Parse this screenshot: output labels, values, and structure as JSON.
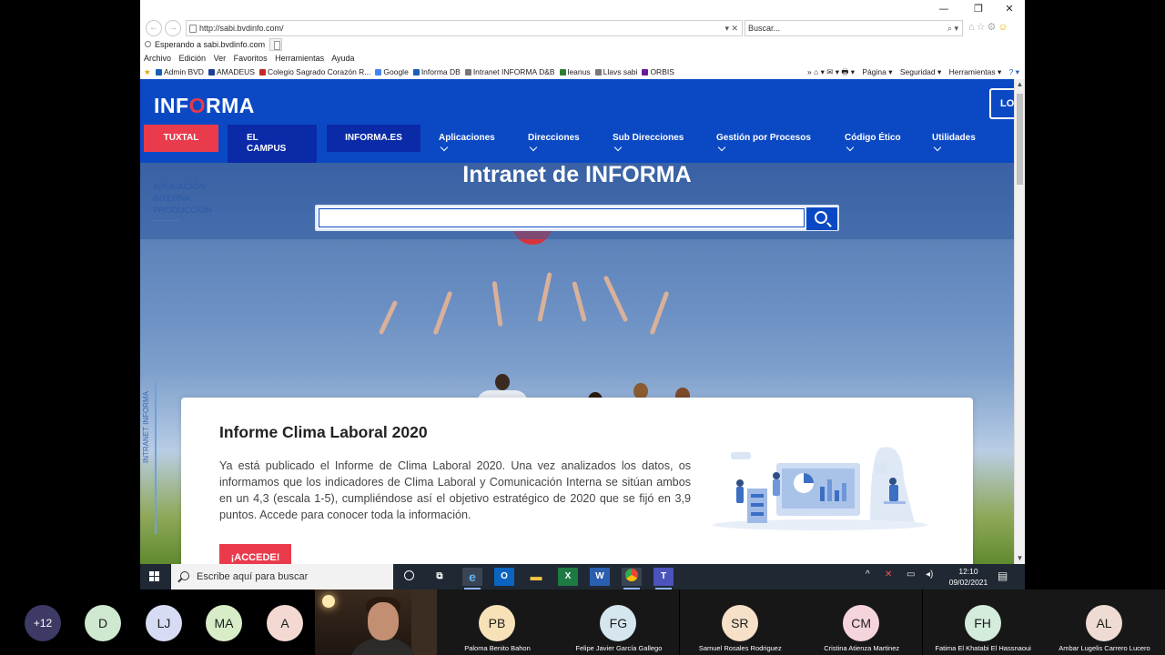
{
  "browser": {
    "window_controls": {
      "minimize": "—",
      "restore": "❐",
      "close": "✕"
    },
    "back_glyph": "←",
    "forward_glyph": "→",
    "url": "http://sabi.bvdinfo.com/",
    "address_controls": "▾  ✕",
    "search_placeholder": "Buscar...",
    "search_controls": "⌕ ▾",
    "tab_title": "Esperando a sabi.bvdinfo.com",
    "tab_close": "✕",
    "menu": [
      "Archivo",
      "Edición",
      "Ver",
      "Favoritos",
      "Herramientas",
      "Ayuda"
    ],
    "favorites": [
      {
        "label": "Admin BVD",
        "color": "#1a5fb4"
      },
      {
        "label": "AMADEUS",
        "color": "#1c3f94"
      },
      {
        "label": "Colegio Sagrado Corazón R...",
        "color": "#c62828"
      },
      {
        "label": "Google",
        "color": "#4285f4"
      },
      {
        "label": "Informa DB",
        "color": "#1a5fb4"
      },
      {
        "label": "Intranet INFORMA D&B",
        "color": "#777777"
      },
      {
        "label": "leanus",
        "color": "#2e7d32"
      },
      {
        "label": "Llavs sabi",
        "color": "#777777"
      },
      {
        "label": "ORBIS",
        "color": "#6a1b9a"
      }
    ],
    "tools": {
      "pagina": "Página ▾",
      "seguridad": "Seguridad ▾",
      "herramientas": "Herramientas ▾",
      "ayuda": "? ▾"
    },
    "tool_icons": "»  ⌂ ▾  ✉ ▾  🖶 ▾"
  },
  "site": {
    "logo_prefix": "INF",
    "logo_dot": "O",
    "logo_suffix": "RMA",
    "login_label": "LO",
    "nav": {
      "tuxtal": "TUXTAL",
      "campus_line1": "EL",
      "campus_line2": "CAMPUS",
      "informa_es": "INFORMA.ES",
      "items": [
        "Aplicaciones",
        "Direcciones",
        "Sub Direcciones",
        "Gestión por Procesos",
        "Código Ético",
        "Utilidades"
      ]
    },
    "hero_title": "Intranet de INFORMA",
    "side_links": [
      "APLICACIÓN",
      "INTERNA",
      "PRODUCCIÓN"
    ],
    "vertical_text": "INTRANET INFORMA",
    "search_value": "",
    "card": {
      "title": "Informe Clima Laboral 2020",
      "text": "Ya está publicado el Informe de Clima Laboral 2020. Una vez analizados los datos, os informamos que los indicadores de Clima Laboral y Comunicación Interna se sitúan ambos en un 4,3 (escala 1-5), cumpliéndose así el objetivo estratégico de 2020 que se fijó en 3,9 puntos. Accede para conocer toda la información.",
      "button": "¡ACCEDE!"
    },
    "accent_blue": "#0b49c4",
    "accent_red": "#ea3b4c"
  },
  "taskbar": {
    "search_placeholder": "Escribe aquí para buscar",
    "time": "12:10",
    "date": "09/02/2021",
    "tray_icons": "^"
  },
  "call": {
    "extra_count": "+12",
    "avatars": [
      {
        "initials": "D",
        "color": "#cfe8d0"
      },
      {
        "initials": "LJ",
        "color": "#d7dcf5"
      },
      {
        "initials": "MA",
        "color": "#d8ecc8"
      },
      {
        "initials": "A",
        "color": "#f3d9d2"
      }
    ],
    "tiles": [
      {
        "initials": "PB",
        "name": "Paloma Benito Bahon",
        "color": "#f7e2b8"
      },
      {
        "initials": "FG",
        "name": "Felipe Javier García Gallego",
        "color": "#d5e6ee"
      },
      {
        "initials": "SR",
        "name": "Samuel Rosales Rodriguez",
        "color": "#f6e0c8"
      },
      {
        "initials": "CM",
        "name": "Cristina Atienza Martinez",
        "color": "#f6d4dc"
      },
      {
        "initials": "FH",
        "name": "Fatima El Khatabi El Hassnaoui",
        "color": "#d3ecdc"
      },
      {
        "initials": "AL",
        "name": "Ambar Lugelis Carrero Lucero",
        "color": "#eedcd4"
      }
    ]
  }
}
